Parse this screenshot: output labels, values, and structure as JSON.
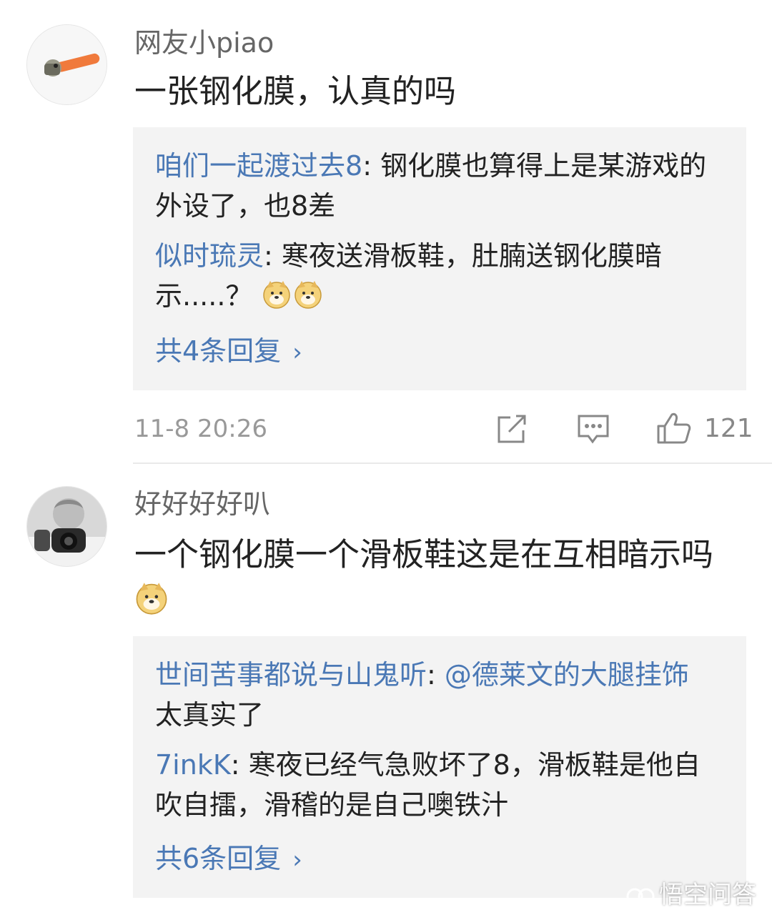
{
  "comments": [
    {
      "username": "网友小piao",
      "text": "一张钢化膜，认真的吗",
      "replies": [
        {
          "name": "咱们一起渡过去8",
          "sep": ": ",
          "text": "钢化膜也算得上是某游戏的外设了，也8差"
        },
        {
          "name": "似时琉灵",
          "sep": ": ",
          "text": "寒夜送滑板鞋，肚腩送钢化膜暗示.....？"
        }
      ],
      "more_replies": "共4条回复",
      "time": "11-8 20:26",
      "likes": "121"
    },
    {
      "username": "好好好好叭",
      "text": "一个钢化膜一个滑板鞋这是在互相暗示吗",
      "replies": [
        {
          "name": "世间苦事都说与山鬼听",
          "sep": ": ",
          "mention": "@德莱文的大腿挂饰",
          "text": " 太真实了"
        },
        {
          "name": "7inkK",
          "sep": ": ",
          "text": "寒夜已经气急败坏了8，滑板鞋是他自吹自擂，滑稽的是自己噢铁汁"
        }
      ],
      "more_replies": "共6条回复"
    }
  ],
  "icons": {
    "share": "share-icon",
    "comment": "comment-icon",
    "like": "thumbs-up-icon",
    "emoji": "doge-emoji-icon"
  },
  "watermark": "悟空问答",
  "colors": {
    "link": "#4a78b5",
    "reply_bg": "#f3f3f3",
    "text": "#222222",
    "muted": "#999999"
  }
}
